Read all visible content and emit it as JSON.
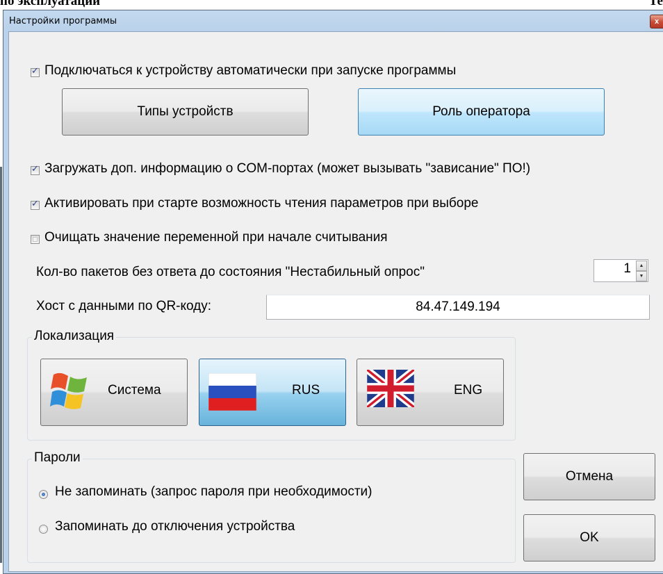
{
  "document": {
    "left_fragment": "по эксплуатации",
    "right_fragment": "Те"
  },
  "window": {
    "title": "Настройки программы",
    "close_symbol": "x"
  },
  "options": {
    "auto_connect": {
      "label": "Подключаться к устройству автоматически при запуске программы",
      "checked": true
    },
    "load_com_info": {
      "label": "Загружать доп. информацию о COM-портах (может вызывать \"зависание\" ПО!)",
      "checked": true
    },
    "activate_read": {
      "label": "Активировать при старте возможность чтения параметров при выборе",
      "checked": true
    },
    "clear_value": {
      "label": "Очищать значение переменной при начале считывания",
      "checked": false
    }
  },
  "buttons": {
    "device_types": "Типы устройств",
    "operator_role": "Роль оператора",
    "cancel": "Отмена",
    "ok": "OK"
  },
  "packets": {
    "label": "Кол-во пакетов без ответа до состояния \"Нестабильный опрос\"",
    "value": "1"
  },
  "qr_host": {
    "label": "Хост с данными по QR-коду:",
    "value": "84.47.149.194"
  },
  "localization": {
    "title": "Локализация",
    "system": "Система",
    "rus": "RUS",
    "eng": "ENG",
    "selected": "RUS"
  },
  "passwords": {
    "title": "Пароли",
    "no_remember": "Не запоминать (запрос пароля при необходимости)",
    "remember": "Запоминать до отключения устройства",
    "selected": "no_remember"
  },
  "colors": {
    "title_bar": "#b9d1ea",
    "client_bg": "#f0f0f0",
    "selected_button": "#a7d9f5"
  }
}
